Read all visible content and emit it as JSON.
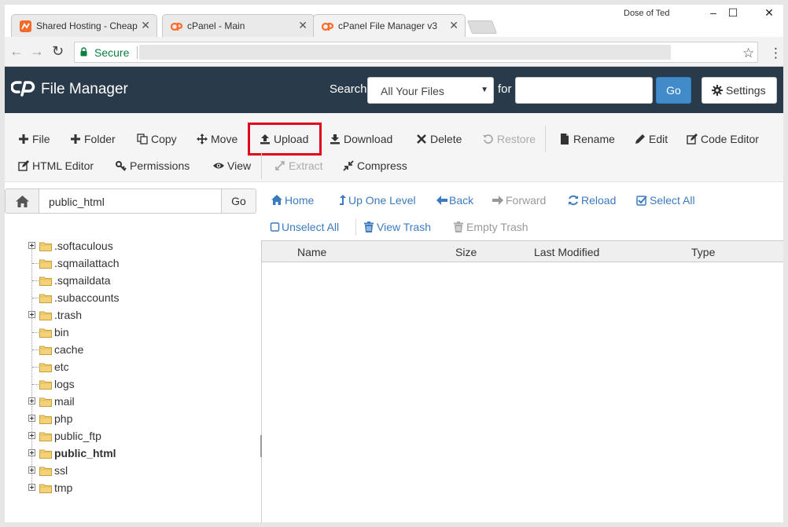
{
  "browser": {
    "tabs": [
      {
        "title": "Shared Hosting - Cheap",
        "active": false
      },
      {
        "title": "cPanel - Main",
        "active": false
      },
      {
        "title": "cPanel File Manager v3",
        "active": true
      }
    ],
    "window_user": "Dose of Ted",
    "secure_label": "Secure"
  },
  "header": {
    "title": "File Manager",
    "search_label": "Search",
    "search_scope": "All Your Files",
    "for_label": "for",
    "go_label": "Go",
    "settings_label": "Settings"
  },
  "toolbar": {
    "row1": [
      {
        "key": "file",
        "label": "File",
        "enabled": true
      },
      {
        "key": "folder",
        "label": "Folder",
        "enabled": true
      },
      {
        "key": "copy",
        "label": "Copy",
        "enabled": true
      },
      {
        "key": "move",
        "label": "Move",
        "enabled": true
      },
      {
        "key": "upload",
        "label": "Upload",
        "enabled": true
      },
      {
        "key": "download",
        "label": "Download",
        "enabled": true
      },
      {
        "key": "delete",
        "label": "Delete",
        "enabled": true
      },
      {
        "key": "restore",
        "label": "Restore",
        "enabled": false
      },
      {
        "key": "rename",
        "label": "Rename",
        "enabled": true
      },
      {
        "key": "edit",
        "label": "Edit",
        "enabled": true
      },
      {
        "key": "code-editor",
        "label": "Code Editor",
        "enabled": true
      }
    ],
    "row2": [
      {
        "key": "html-editor",
        "label": "HTML Editor",
        "enabled": true
      },
      {
        "key": "permissions",
        "label": "Permissions",
        "enabled": true
      },
      {
        "key": "view",
        "label": "View",
        "enabled": true
      },
      {
        "key": "extract",
        "label": "Extract",
        "enabled": false
      },
      {
        "key": "compress",
        "label": "Compress",
        "enabled": true
      }
    ]
  },
  "pathbar": {
    "path": "public_html",
    "go_label": "Go"
  },
  "navlinks": {
    "row1": [
      {
        "key": "home",
        "label": "Home",
        "enabled": true
      },
      {
        "key": "up-one-level",
        "label": "Up One Level",
        "enabled": true
      },
      {
        "key": "back",
        "label": "Back",
        "enabled": true
      },
      {
        "key": "forward",
        "label": "Forward",
        "enabled": false
      },
      {
        "key": "reload",
        "label": "Reload",
        "enabled": true
      },
      {
        "key": "select-all",
        "label": "Select All",
        "enabled": true
      }
    ],
    "row2": [
      {
        "key": "unselect-all",
        "label": "Unselect All",
        "enabled": true
      },
      {
        "key": "view-trash",
        "label": "View Trash",
        "enabled": true
      },
      {
        "key": "empty-trash",
        "label": "Empty Trash",
        "enabled": false
      }
    ]
  },
  "tree": [
    {
      "name": ".softaculous",
      "expandable": true,
      "bold": false
    },
    {
      "name": ".sqmailattach",
      "expandable": false,
      "bold": false
    },
    {
      "name": ".sqmaildata",
      "expandable": false,
      "bold": false
    },
    {
      "name": ".subaccounts",
      "expandable": false,
      "bold": false
    },
    {
      "name": ".trash",
      "expandable": true,
      "bold": false
    },
    {
      "name": "bin",
      "expandable": false,
      "bold": false
    },
    {
      "name": "cache",
      "expandable": false,
      "bold": false
    },
    {
      "name": "etc",
      "expandable": false,
      "bold": false
    },
    {
      "name": "logs",
      "expandable": false,
      "bold": false
    },
    {
      "name": "mail",
      "expandable": true,
      "bold": false
    },
    {
      "name": "php",
      "expandable": true,
      "bold": false
    },
    {
      "name": "public_ftp",
      "expandable": true,
      "bold": false
    },
    {
      "name": "public_html",
      "expandable": true,
      "bold": true
    },
    {
      "name": "ssl",
      "expandable": true,
      "bold": false
    },
    {
      "name": "tmp",
      "expandable": true,
      "bold": false
    }
  ],
  "filelist": {
    "columns": [
      "Name",
      "Size",
      "Last Modified",
      "Type"
    ]
  },
  "colors": {
    "header_bg": "#293a4a",
    "accent": "#428bca",
    "link": "#3c7bbf",
    "highlight": "#e0001b"
  }
}
